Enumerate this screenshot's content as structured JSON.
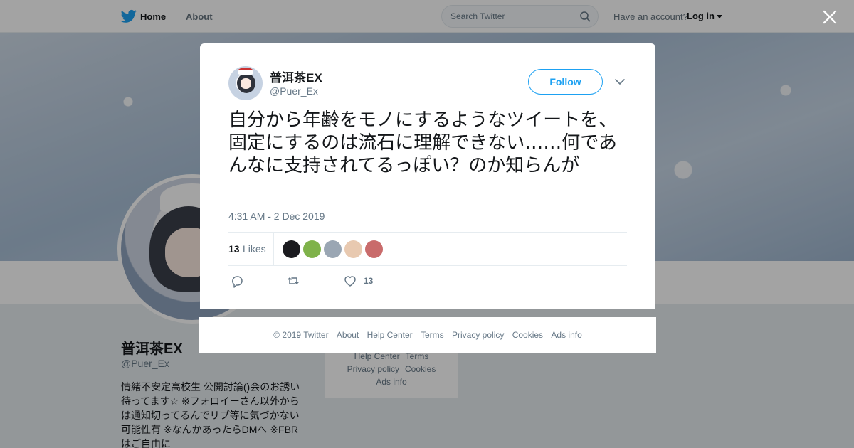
{
  "topbar": {
    "home_label": "Home",
    "about_label": "About",
    "search_placeholder": "Search Twitter",
    "have_account": "Have an account?",
    "login_label": "Log in"
  },
  "profile": {
    "name": "普洱茶EX",
    "handle": "@Puer_Ex",
    "bio": "情緒不安定高校生 公開討論()会のお誘い待ってます☆ ※フォロイーさん以外からは通知切ってるんでリプ等に気づかない可能性有 ※なんかあったらDMへ ※FBRはご自由に",
    "links": [
      "Help Center",
      "Terms",
      "Privacy policy",
      "Cookies",
      "Ads info"
    ]
  },
  "tweet": {
    "display_name": "普洱茶EX",
    "handle": "@Puer_Ex",
    "follow_label": "Follow",
    "text": "自分から年齢をモノにするようなツイートを、固定にするのは流石に理解できない……何であんなに支持されてるっぽい？のか知らんが",
    "timestamp": "4:31 AM - 2 Dec 2019",
    "likes_count": "13",
    "likes_label": "Likes",
    "like_action_count": "13",
    "liker_colors": [
      "#1b1b1f",
      "#7fb24a",
      "#9aa6b3",
      "#e8c9b0",
      "#c96b6b"
    ]
  },
  "footer": {
    "items": [
      "© 2019 Twitter",
      "About",
      "Help Center",
      "Terms",
      "Privacy policy",
      "Cookies",
      "Ads info"
    ]
  },
  "colors": {
    "accent": "#1da1f2",
    "muted": "#657786",
    "text": "#14171a"
  },
  "icons": [
    "twitter-bird-icon",
    "search-icon",
    "close-icon",
    "chevron-down-icon",
    "reply-icon",
    "retweet-icon",
    "heart-icon"
  ]
}
